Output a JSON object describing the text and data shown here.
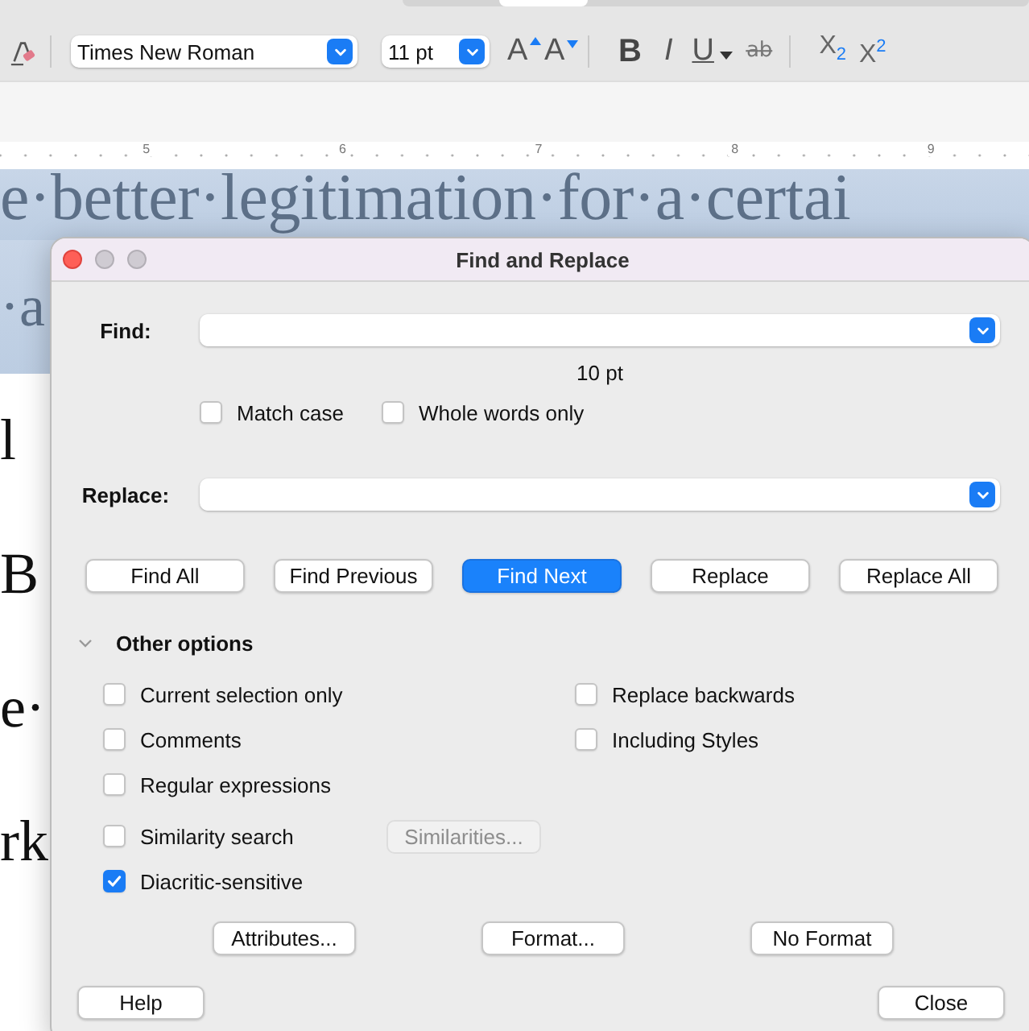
{
  "toolbar": {
    "font_name": "Times New Roman",
    "font_size": "11 pt",
    "buttons": [
      {
        "kind": "grow",
        "glyph": "A"
      },
      {
        "kind": "shrink",
        "glyph": "A"
      },
      {
        "kind": "bold",
        "glyph": "B"
      },
      {
        "kind": "italic",
        "glyph": "I"
      },
      {
        "kind": "underline",
        "glyph": "U"
      },
      {
        "kind": "strike",
        "glyph": "a̶b̶"
      },
      {
        "kind": "subscript",
        "glyph": "X$_{2}$"
      },
      {
        "kind": "superscript",
        "glyph": "X$^{2}$"
      }
    ]
  },
  "ruler": {
    "labels": [
      "5",
      "6",
      "7",
      "8",
      "9"
    ]
  },
  "document": {
    "lines": [
      {
        "text": "e·better·legitimation·for·a·certai",
        "selected": true
      },
      {
        "text": "·a",
        "selected": true
      },
      {
        "text": "l",
        "selected": false
      },
      {
        "text": "B",
        "selected": false
      },
      {
        "text": "e·",
        "selected": false
      },
      {
        "text": "rk",
        "selected": false
      }
    ]
  },
  "dialog": {
    "title": "Find and Replace",
    "find_label": "Find:",
    "size_hint": "10 pt",
    "find_options": [
      {
        "label": "Match case",
        "checked": false
      },
      {
        "label": "Whole words only",
        "checked": false
      }
    ],
    "replace_label": "Replace:",
    "actions": [
      {
        "label": "Find All",
        "default": false
      },
      {
        "label": "Find Previous",
        "default": false
      },
      {
        "label": "Find Next",
        "default": true
      },
      {
        "label": "Replace",
        "default": false
      },
      {
        "label": "Replace All",
        "default": false
      }
    ],
    "other_options": {
      "label": "Other options",
      "expanded": true,
      "rows": [
        {
          "items": [
            {
              "kind": "checkbox",
              "label": "Current selection only",
              "checked": false
            },
            {
              "kind": "checkbox",
              "label": "Replace backwards",
              "checked": false
            }
          ]
        },
        {
          "items": [
            {
              "kind": "checkbox",
              "label": "Comments",
              "checked": false
            },
            {
              "kind": "checkbox",
              "label": "Including Styles",
              "checked": false
            }
          ]
        },
        {
          "items": [
            {
              "kind": "checkbox",
              "label": "Regular expressions",
              "checked": false
            }
          ]
        },
        {
          "items": [
            {
              "kind": "checkbox",
              "label": "Similarity search",
              "checked": false
            },
            {
              "kind": "button",
              "label": "Similarities...",
              "disabled": true
            }
          ]
        },
        {
          "items": [
            {
              "kind": "checkbox",
              "label": "Diacritic-sensitive",
              "checked": true
            }
          ]
        }
      ],
      "buttons": [
        {
          "label": "Attributes..."
        },
        {
          "label": "Format..."
        },
        {
          "label": "No Format"
        }
      ]
    },
    "footer_buttons": [
      {
        "label": "Help"
      },
      {
        "label": "Close"
      }
    ]
  }
}
